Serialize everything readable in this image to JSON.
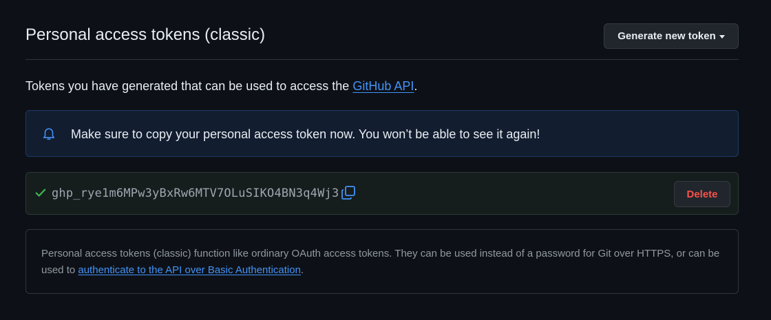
{
  "header": {
    "title": "Personal access tokens (classic)",
    "generate_button_label": "Generate new token"
  },
  "intro": {
    "text_before": "Tokens you have generated that can be used to access the ",
    "link_text": "GitHub API",
    "text_after": "."
  },
  "flash": {
    "icon": "bell-icon",
    "message": "Make sure to copy your personal access token now. You won’t be able to see it again!"
  },
  "token": {
    "status_icon": "check-icon",
    "value": "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",
    "copy_icon": "copy-icon",
    "delete_label": "Delete"
  },
  "info": {
    "text_before": "Personal access tokens (classic) function like ordinary OAuth access tokens. They can be used instead of a password for Git over HTTPS, or can be used to ",
    "link_text": "authenticate to the API over Basic Authentication",
    "text_after": "."
  },
  "colors": {
    "background": "#0d1117",
    "link": "#4493f8",
    "success": "#3fb950",
    "danger": "#f85149",
    "flash_border": "#1f3a63"
  }
}
